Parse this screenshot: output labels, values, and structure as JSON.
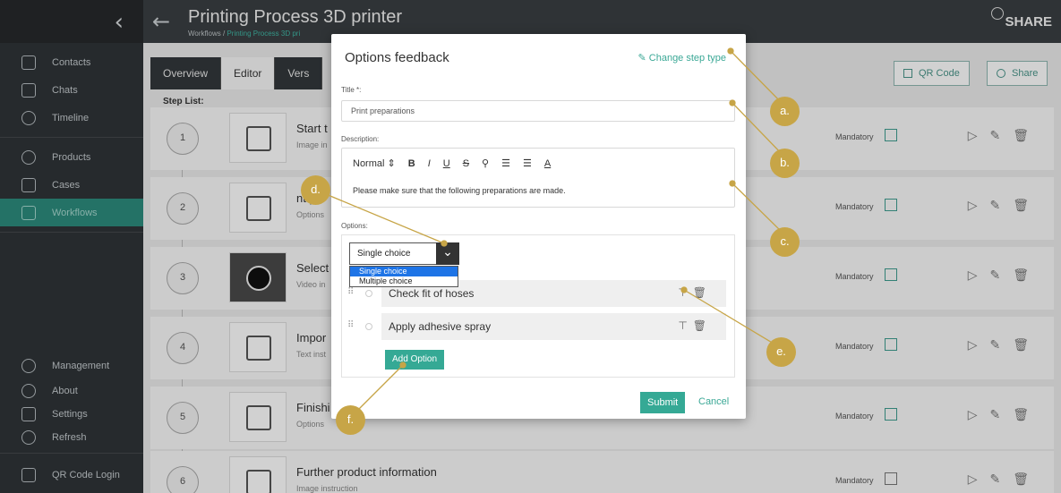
{
  "sidebar": {
    "back_icon": "chevron-left",
    "groups": [
      [
        {
          "label": "Contacts",
          "icon": "contacts-icon"
        },
        {
          "label": "Chats",
          "icon": "chats-icon"
        },
        {
          "label": "Timeline",
          "icon": "timeline-icon"
        }
      ],
      [
        {
          "label": "Products",
          "icon": "products-icon"
        },
        {
          "label": "Cases",
          "icon": "cases-icon"
        },
        {
          "label": "Workflows",
          "icon": "workflows-icon",
          "active": true
        }
      ]
    ],
    "bottom": [
      {
        "label": "Management",
        "icon": "management-icon"
      },
      {
        "label": "About",
        "icon": "about-icon"
      },
      {
        "label": "Settings",
        "icon": "settings-icon"
      },
      {
        "label": "Refresh",
        "icon": "refresh-icon"
      },
      {
        "label": "QR Code Login",
        "icon": "qr-icon"
      }
    ]
  },
  "topbar": {
    "title": "Printing Process 3D printer",
    "crumb_root": "Workflows /",
    "crumb_current": "Printing Process 3D pri",
    "share": "SHARE"
  },
  "tabs": [
    "Overview",
    "Editor",
    "Vers"
  ],
  "steplist_label": "Step List:",
  "tools": {
    "qr": "QR Code",
    "share": "Share"
  },
  "steps": [
    {
      "num": "1",
      "title": "Start t",
      "sub": "Image in",
      "mandatory": "Mandatory",
      "checked": true
    },
    {
      "num": "2",
      "title": "nt p",
      "sub": "Options",
      "mandatory": "Mandatory",
      "checked": true
    },
    {
      "num": "3",
      "title": "Select",
      "sub": "Video in",
      "mandatory": "Mandatory",
      "checked": true
    },
    {
      "num": "4",
      "title": "Impor",
      "sub": "Text inst",
      "mandatory": "Mandatory",
      "checked": true
    },
    {
      "num": "5",
      "title": "Finishi",
      "sub": "Options",
      "mandatory": "Mandatory",
      "checked": true
    },
    {
      "num": "6",
      "title": "Further product information",
      "sub": "Image instruction",
      "mandatory": "Mandatory",
      "checked": false
    }
  ],
  "modal": {
    "title": "Options feedback",
    "change_type": "Change step type",
    "title_label": "Title *:",
    "title_value": "Print preparations",
    "description_label": "Description:",
    "toolbar": {
      "style": "Normal",
      "bold": "B",
      "italic": "I",
      "underline": "U",
      "strike": "S",
      "link": "🔗",
      "align": "A"
    },
    "description_text": "Please make sure that the following preparations are made.",
    "options_label": "Options:",
    "select_value": "Single choice",
    "dropdown": [
      "Single choice",
      "Multiple choice"
    ],
    "options": [
      "Check fit of hoses",
      "Apply adhesive spray"
    ],
    "add_option": "Add Option",
    "submit": "Submit",
    "cancel": "Cancel"
  },
  "callouts": {
    "a": "a.",
    "b": "b.",
    "c": "c.",
    "d": "d.",
    "e": "e.",
    "f": "f."
  },
  "colors": {
    "accent": "#35a995",
    "callout": "#c7a547",
    "sidebar": "#2f3437",
    "selected": "#1e74e6"
  }
}
